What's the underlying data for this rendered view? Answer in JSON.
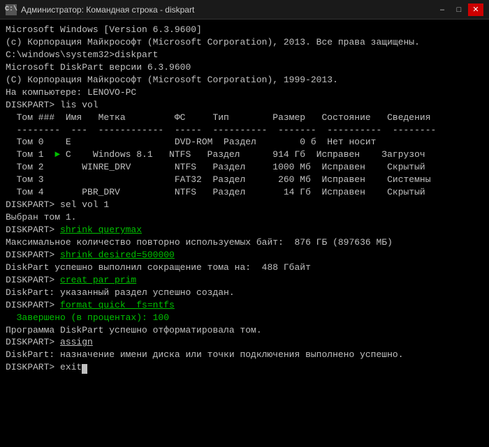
{
  "titleBar": {
    "icon": "C:\\",
    "title": "Администратор: Командная строка - diskpart",
    "minimize": "–",
    "maximize": "□",
    "close": "✕"
  },
  "console": {
    "lines": [
      {
        "text": "Microsoft Windows [Version 6.3.9600]",
        "color": "gray"
      },
      {
        "text": "(c) Корпорация Майкрософт (Microsoft Corporation), 2013. Все права защищены.",
        "color": "gray"
      },
      {
        "text": "",
        "color": "gray"
      },
      {
        "text": "C:\\windows\\system32>diskpart",
        "color": "gray"
      },
      {
        "text": "",
        "color": "gray"
      },
      {
        "text": "Microsoft DiskPart версии 6.3.9600",
        "color": "gray"
      },
      {
        "text": "",
        "color": "gray"
      },
      {
        "text": "(C) Корпорация Майкрософт (Microsoft Corporation), 1999-2013.",
        "color": "gray"
      },
      {
        "text": "На компьютере: LENOVO-PC",
        "color": "gray"
      },
      {
        "text": "",
        "color": "gray"
      },
      {
        "text": "DISKPART> lis vol",
        "color": "gray"
      },
      {
        "text": "",
        "color": "gray"
      },
      {
        "text": "  Том ###  Имя   Метка         ФС     Тип        Размер   Состояние   Сведения",
        "color": "gray"
      },
      {
        "text": "  --------  ---  ------------  -----  ----------  -------  ----------  --------",
        "color": "gray"
      },
      {
        "text": "  Том 0    E                   DVD-ROM  Раздел        0 б  Нет носит",
        "color": "gray"
      },
      {
        "text": "  Том 1  ► C    Windows 8.1   NTFS   Раздел      914 Гб  Исправен    Загрузоч",
        "color": "gray",
        "hasArrow": true
      },
      {
        "text": "  Том 2       WINRE_DRV        NTFS   Раздел     1000 Мб  Исправен    Скрытый",
        "color": "gray"
      },
      {
        "text": "  Том 3                        FAT32  Раздел      260 Мб  Исправен    Системны",
        "color": "gray"
      },
      {
        "text": "  Том 4       PBR_DRV          NTFS   Раздел       14 Гб  Исправен    Скрытый",
        "color": "gray"
      },
      {
        "text": "",
        "color": "gray"
      },
      {
        "text": "DISKPART> sel vol 1",
        "color": "gray"
      },
      {
        "text": "",
        "color": "gray"
      },
      {
        "text": "Выбран том 1.",
        "color": "gray"
      },
      {
        "text": "",
        "color": "gray"
      },
      {
        "text": "DISKPART> shrink querymax",
        "color": "green",
        "cmdPart": "shrink querymax"
      },
      {
        "text": "",
        "color": "gray"
      },
      {
        "text": "Максимальное количество повторно используемых байт:  876 ГБ (897636 МБ)",
        "color": "gray"
      },
      {
        "text": "",
        "color": "gray"
      },
      {
        "text": "DISKPART> shrink desired=500000",
        "color": "green",
        "cmdPart": "shrink desired=500000"
      },
      {
        "text": "",
        "color": "gray"
      },
      {
        "text": "DiskPart успешно выполнил сокращение тома на:  488 Гбайт",
        "color": "gray"
      },
      {
        "text": "",
        "color": "gray"
      },
      {
        "text": "DISKPART> creat par prim",
        "color": "green",
        "cmdPart": "creat par prim"
      },
      {
        "text": "",
        "color": "gray"
      },
      {
        "text": "DiskPart: указанный раздел успешно создан.",
        "color": "gray"
      },
      {
        "text": "",
        "color": "gray"
      },
      {
        "text": "DISKPART> format quick  fs=ntfs",
        "color": "green",
        "cmdPart": "format quick  fs=ntfs"
      },
      {
        "text": "",
        "color": "gray"
      },
      {
        "text": "  Завершено (в процентах): 100",
        "color": "green"
      },
      {
        "text": "",
        "color": "gray"
      },
      {
        "text": "Программа DiskPart успешно отформатировала том.",
        "color": "gray"
      },
      {
        "text": "",
        "color": "gray"
      },
      {
        "text": "DISKPART> assign",
        "color": "gray",
        "cmdHighlight": "assign"
      },
      {
        "text": "",
        "color": "gray"
      },
      {
        "text": "DiskPart: назначение имени диска или точки подключения выполнено успешно.",
        "color": "gray"
      },
      {
        "text": "",
        "color": "gray"
      },
      {
        "text": "DISKPART> exit",
        "color": "gray",
        "hasCursor": true
      }
    ]
  }
}
